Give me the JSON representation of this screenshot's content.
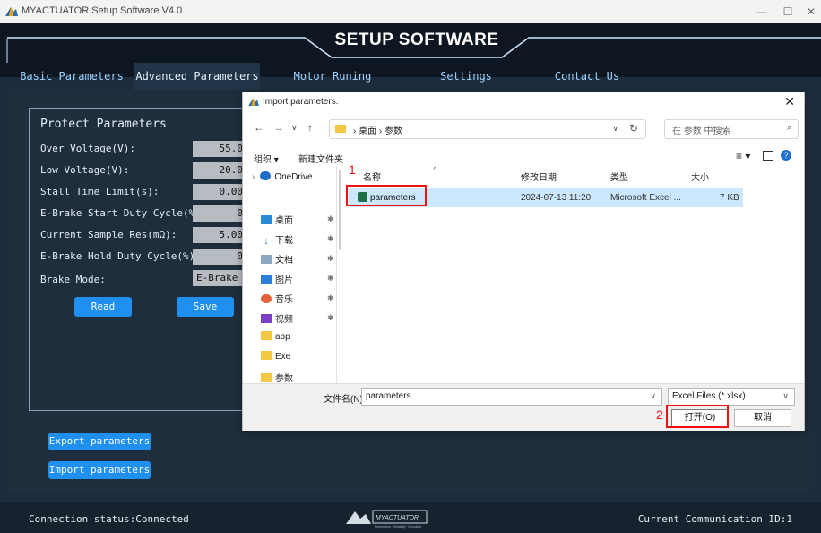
{
  "window": {
    "title": "MYACTUATOR Setup Software V4.0"
  },
  "header": {
    "title": "SETUP SOFTWARE"
  },
  "tabs": [
    {
      "label": "Basic Parameters"
    },
    {
      "label": "Advanced Parameters"
    },
    {
      "label": "Motor Runing"
    },
    {
      "label": "Settings"
    },
    {
      "label": "Contact Us"
    }
  ],
  "panel": {
    "title": "Protect Parameters",
    "rows": [
      {
        "label": "Over Voltage(V):",
        "value": "55.0"
      },
      {
        "label": "Low Voltage(V):",
        "value": "20.0"
      },
      {
        "label": "Stall Time Limit(s):",
        "value": "0.00"
      },
      {
        "label": "E-Brake Start Duty Cycle(%):",
        "value": "0"
      },
      {
        "label": "Current Sample Res(mΩ):",
        "value": "5.00"
      },
      {
        "label": "E-Brake Hold Duty Cycle(%):",
        "value": "0"
      },
      {
        "label": "Brake Mode:",
        "value": "E-Brake"
      }
    ],
    "read_label": "Read",
    "save_label": "Save"
  },
  "buttons": {
    "export": "Export parameters",
    "import": "Import parameters"
  },
  "footer": {
    "status": "Connection status:Connected",
    "comm": "Current Communication ID:1",
    "logo_text": "MYACTUATOR",
    "logo_sub": "Performance · Reliability · Innovation"
  },
  "dialog": {
    "title": "Import parameters.",
    "breadcrumb": [
      "桌面",
      "参数"
    ],
    "search_placeholder": "在 参数 中搜索",
    "toolbar": {
      "organize": "组织 ▾",
      "new_folder": "新建文件夹"
    },
    "sidebar": [
      {
        "label": "OneDrive",
        "icon": "cloud-icon"
      },
      {
        "label": "桌面",
        "icon": "desktop-icon"
      },
      {
        "label": "下载",
        "icon": "download-icon"
      },
      {
        "label": "文档",
        "icon": "document-icon"
      },
      {
        "label": "图片",
        "icon": "picture-icon"
      },
      {
        "label": "音乐",
        "icon": "music-icon"
      },
      {
        "label": "视频",
        "icon": "video-icon"
      },
      {
        "label": "app",
        "icon": "folder-icon"
      },
      {
        "label": "Exe",
        "icon": "folder-icon"
      },
      {
        "label": "参数",
        "icon": "folder-icon"
      }
    ],
    "columns": [
      "名称",
      "修改日期",
      "类型",
      "大小"
    ],
    "files": [
      {
        "name": "parameters",
        "date": "2024-07-13 11:20",
        "type": "Microsoft Excel ...",
        "size": "7 KB"
      }
    ],
    "filename_label": "文件名(N):",
    "filename_value": "parameters",
    "filetype": "Excel Files (*.xlsx)",
    "open_label": "打开(O)",
    "cancel_label": "取消",
    "step1": "1",
    "step2": "2"
  },
  "colors": {
    "accent_blue": "#1f8ff0",
    "highlight_red": "#e11",
    "selection": "#cce8ff",
    "bg_dark": "#1d2c3c"
  }
}
